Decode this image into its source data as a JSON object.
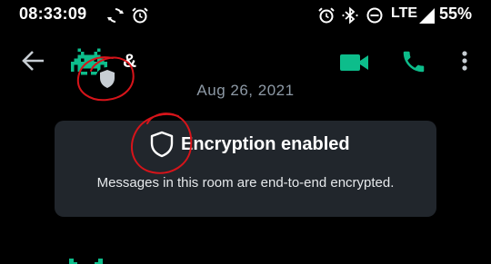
{
  "status_bar": {
    "time": "08:33:09",
    "network": "LTE",
    "battery": "55%",
    "icons": [
      "sync-icon",
      "alarm-icon",
      "alarm-icon",
      "bluetooth-icon",
      "do-not-disturb-icon",
      "signal-icon"
    ]
  },
  "app_bar": {
    "back_icon": "arrow-left-icon",
    "room_name": "&",
    "avatar_icon": "space-invader-icon",
    "shield_icon": "shield-icon",
    "actions": [
      "video-call-icon",
      "voice-call-icon",
      "more-vert-icon"
    ]
  },
  "timeline": {
    "date_separator": "Aug 26, 2021",
    "encryption_card": {
      "icon": "shield-icon",
      "title": "Encryption enabled",
      "body": "Messages in this room are end-to-end encrypted."
    }
  },
  "colors": {
    "background": "#000000",
    "card_background": "#21262c",
    "accent_green": "#0dbd8b",
    "secondary_text": "#8d99a5",
    "annotation_red": "#d7141a"
  }
}
